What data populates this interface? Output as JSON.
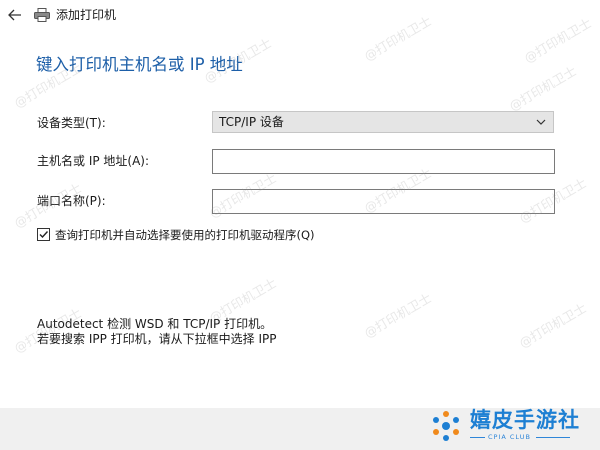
{
  "window": {
    "title": "添加打印机",
    "back_icon": "arrow-left-icon",
    "printer_icon": "printer-icon"
  },
  "heading": "键入打印机主机名或 IP 地址",
  "form": {
    "device_type_label": "设备类型(T):",
    "device_type_value": "TCP/IP 设备",
    "hostname_label": "主机名或 IP 地址(A):",
    "hostname_value": "",
    "port_label": "端口名称(P):",
    "port_value": "",
    "auto_select_label": "查询打印机并自动选择要使用的打印机驱动程序(Q)",
    "auto_select_checked": true
  },
  "info": {
    "line1": "Autodetect 检测 WSD 和 TCP/IP 打印机。",
    "line2": "若要搜索 IPP 打印机，请从下拉框中选择 IPP"
  },
  "watermark": {
    "text": "@打印机卫士"
  },
  "logo": {
    "name": "嬉皮手游社",
    "sub": "CPIA CLUB"
  },
  "colors": {
    "heading": "#1d5fa8",
    "select_bg": "#e5e5e5",
    "footer_bg": "#f0f0f0",
    "logo_blue": "#1d7fd3",
    "logo_orange": "#f08a1c"
  }
}
